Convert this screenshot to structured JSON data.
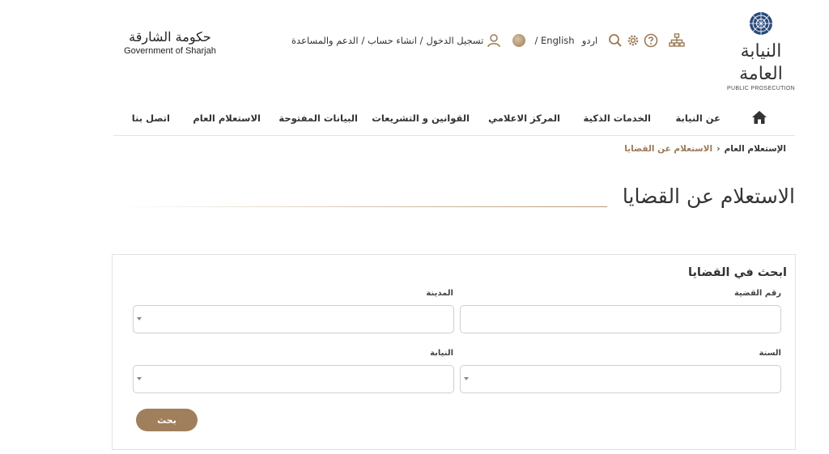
{
  "header": {
    "logo_pp_arabic": "النيابة العامة",
    "logo_pp_english": "PUBLIC PROSECUTION",
    "logo_gov_arabic": "حكومة الشارقة",
    "logo_gov_english": "Government of Sharjah"
  },
  "topbar": {
    "sitemap_icon": "sitemap-icon",
    "help_icon": "help-icon",
    "settings_icon": "gear-icon",
    "search_icon": "search-icon",
    "lang_urdu": "اردو",
    "lang_english": "English /",
    "login": "تسجيل الدخول",
    "create_account": "/ انشاء حساب /",
    "support": "الدعم والمساعدة"
  },
  "nav": {
    "items": [
      "عن النيابة",
      "الخدمات الذكية",
      "المركز الاعلامي",
      "القوانين و التشريعات",
      "البيانات المفتوحة",
      "الاستعلام العام",
      "اتصل بنا"
    ]
  },
  "breadcrumb": {
    "parent": "الإستعلام العام",
    "current": "الاستعلام عن القضايا"
  },
  "page": {
    "title": "الاستعلام عن القضايا"
  },
  "search": {
    "title": "ابحث في القضايا",
    "case_number_label": "رقم القضية",
    "case_number_value": "",
    "city_label": "المدينة",
    "city_value": "",
    "year_label": "السنة",
    "year_value": "",
    "prosecution_label": "النيابة",
    "prosecution_value": "",
    "submit_label": "بحث"
  },
  "colors": {
    "accent": "#a07f5c",
    "breadcrumb_current": "#9b7a55",
    "emblem": "#2a4a7a"
  }
}
